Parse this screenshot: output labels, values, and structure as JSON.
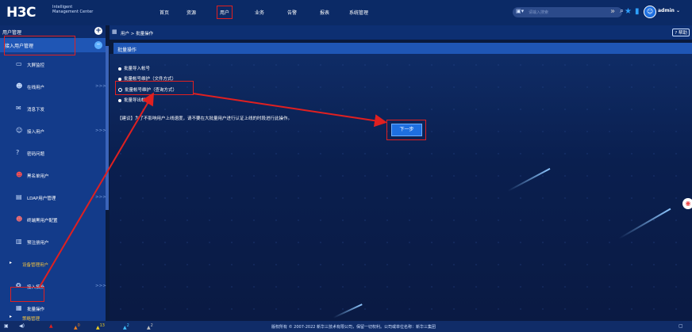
{
  "app": {
    "logo": "H3C",
    "logo_sub_line1": "Intelligent",
    "logo_sub_line2": "Management Center"
  },
  "topnav": [
    {
      "label": "首页"
    },
    {
      "label": "资源"
    },
    {
      "label": "用户"
    },
    {
      "label": "业务"
    },
    {
      "label": "告警"
    },
    {
      "label": "报表"
    },
    {
      "label": "系统管理"
    }
  ],
  "search": {
    "placeholder": "请输入搜索"
  },
  "user": {
    "name": "admin"
  },
  "sidebar": {
    "header": "用户管理",
    "section": "接入用户管理",
    "items": [
      {
        "label": "大屏监控",
        "icon": "monitor-icon"
      },
      {
        "label": "在线用户",
        "icon": "users-icon",
        "arrow": ">>>"
      },
      {
        "label": "消息下发",
        "icon": "message-icon"
      },
      {
        "label": "接入用户",
        "icon": "user-icon",
        "arrow": ">>>"
      },
      {
        "label": "密码问题",
        "icon": "question-icon"
      },
      {
        "label": "黑名单用户",
        "icon": "blacklist-icon"
      },
      {
        "label": "LDAP用户管理",
        "icon": "ldap-icon",
        "arrow": ">>>"
      },
      {
        "label": "终端黑用户配置",
        "icon": "terminal-icon"
      },
      {
        "label": "预注册用户",
        "icon": "register-icon"
      },
      {
        "label": "设备管理用户",
        "icon": "triangle-icon"
      },
      {
        "label": "接入拓扑",
        "icon": "topology-icon",
        "arrow": ">>>"
      },
      {
        "label": "批量操作",
        "icon": "batch-icon"
      },
      {
        "label": "策略管理",
        "icon": "triangle-icon"
      }
    ]
  },
  "breadcrumb": "用户 > 批量操作",
  "help_label": "帮助",
  "panel": {
    "title": "批量操作",
    "options": [
      {
        "label": "批量导入帐号",
        "selected": false
      },
      {
        "label": "批量帐号维护（文件方式）",
        "selected": false
      },
      {
        "label": "批量帐号维护（查询方式）",
        "selected": true
      },
      {
        "label": "批量导出帐号",
        "selected": false
      }
    ],
    "tip": "【建议】为了不影响用户上线速度，请不要在大批量用户进行认证上线的时段进行此操作。",
    "next_button": "下一步"
  },
  "statusbar": {
    "items": [
      {
        "label": "",
        "icon": "alert-triangle-icon",
        "color": "#e02020"
      },
      {
        "label": "0",
        "icon": "alert-triangle-icon",
        "color": "#f08020"
      },
      {
        "label": "13",
        "icon": "alert-triangle-icon",
        "color": "#f0d020"
      },
      {
        "label": "2",
        "icon": "alert-triangle-icon",
        "color": "#40c0ff"
      },
      {
        "label": "2",
        "icon": "alert-triangle-icon",
        "color": "#c0c0c0"
      }
    ],
    "copyright": "版权所有 © 2007-2022 新华三技术有限公司，保留一切权利。公司或单位名称：新华三集团"
  }
}
